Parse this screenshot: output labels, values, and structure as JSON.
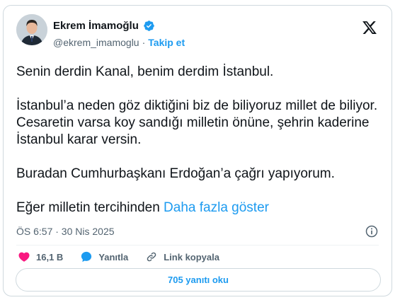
{
  "author": {
    "name": "Ekrem İmamoğlu",
    "handle": "@ekrem_imamoglu",
    "separator": "·",
    "follow_label": "Takip et"
  },
  "tweet": {
    "paragraphs": [
      "Senin derdin Kanal, benim derdim İstanbul.",
      "İstanbul’a neden göz diktiğini biz de biliyoruz millet de biliyor. Cesaretin varsa koy sandığı milletin önüne, şehrin kaderine İstanbul karar versin.",
      "Buradan Cumhurbaşkanı Erdoğan’a çağrı yapıyorum."
    ],
    "truncated_text": "Eğer milletin tercihinden",
    "show_more_label": "Daha fazla göster",
    "timestamp": "ÖS 6:57 · 30 Nis 2025"
  },
  "actions": {
    "like_count": "16,1 B",
    "reply_label": "Yanıtla",
    "copy_link_label": "Link kopyala"
  },
  "read_replies_label": "705 yanıtı oku",
  "colors": {
    "accent": "#1d9bf0",
    "like": "#f91880",
    "text": "#0f1419",
    "secondary": "#536471",
    "border": "#cfd9de"
  },
  "icons": [
    "verified-badge-icon",
    "x-logo-icon",
    "info-icon",
    "heart-icon",
    "reply-icon",
    "link-icon"
  ]
}
